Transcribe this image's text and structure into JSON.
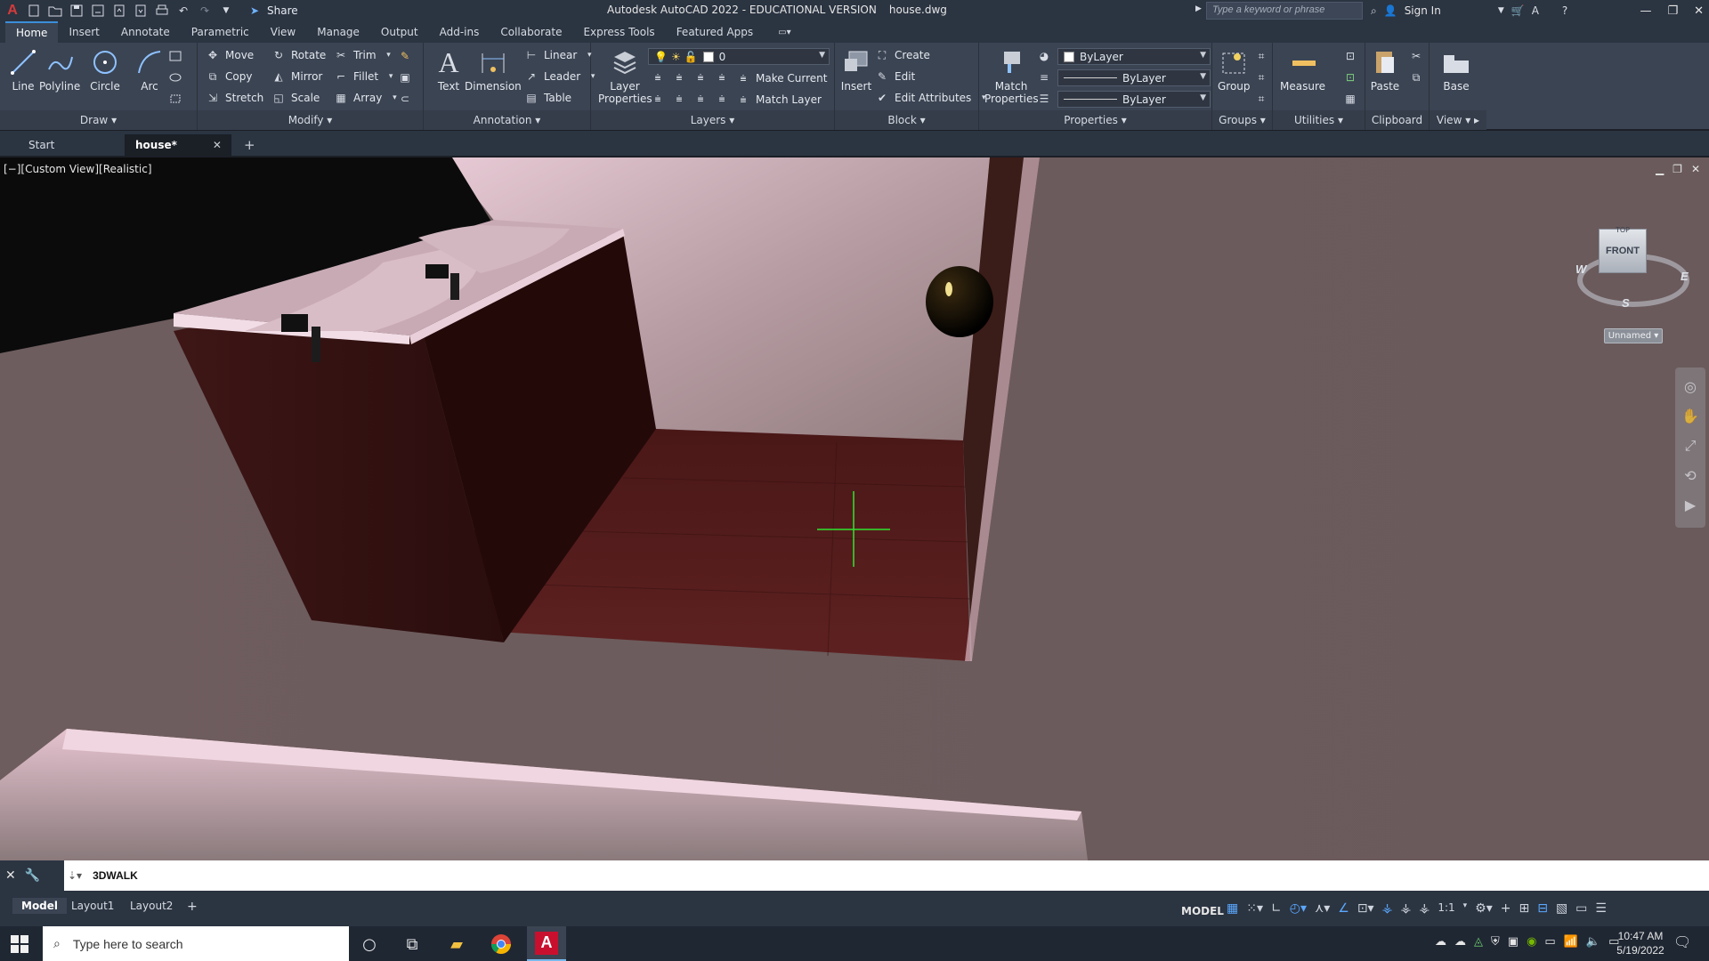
{
  "titlebar": {
    "app_title": "Autodesk AutoCAD 2022 - EDUCATIONAL VERSION",
    "file_name": "house.dwg",
    "share_label": "Share",
    "search_placeholder": "Type a keyword or phrase",
    "sign_in": "Sign In"
  },
  "ribbon_tabs": [
    "Home",
    "Insert",
    "Annotate",
    "Parametric",
    "View",
    "Manage",
    "Output",
    "Add-ins",
    "Collaborate",
    "Express Tools",
    "Featured Apps"
  ],
  "ribbon": {
    "draw": {
      "label": "Draw",
      "line": "Line",
      "polyline": "Polyline",
      "circle": "Circle",
      "arc": "Arc"
    },
    "modify": {
      "label": "Modify",
      "move": "Move",
      "rotate": "Rotate",
      "trim": "Trim",
      "copy": "Copy",
      "mirror": "Mirror",
      "fillet": "Fillet",
      "stretch": "Stretch",
      "scale": "Scale",
      "array": "Array"
    },
    "annotation": {
      "label": "Annotation",
      "text": "Text",
      "dimension": "Dimension",
      "linear": "Linear",
      "leader": "Leader",
      "table": "Table"
    },
    "layers": {
      "label": "Layers",
      "layer_properties": "Layer Properties",
      "current_layer": "0",
      "make_current": "Make Current",
      "match_layer": "Match Layer"
    },
    "block": {
      "label": "Block",
      "insert": "Insert",
      "create": "Create",
      "edit": "Edit",
      "edit_attributes": "Edit Attributes"
    },
    "properties": {
      "label": "Properties",
      "match_properties": "Match Properties",
      "color": "ByLayer",
      "linetype": "ByLayer",
      "lineweight": "ByLayer"
    },
    "groups": {
      "label": "Groups",
      "group": "Group"
    },
    "utilities": {
      "label": "Utilities",
      "measure": "Measure"
    },
    "clipboard": {
      "label": "Clipboard",
      "paste": "Paste"
    },
    "view": {
      "label": "View",
      "base": "Base"
    }
  },
  "doc_tabs": {
    "start": "Start",
    "active": "house*"
  },
  "viewport": {
    "label": "[−][Custom View][Realistic]",
    "viewcube_face": "FRONT",
    "viewcube_top": "TOP",
    "compass_w": "W",
    "compass_e": "E",
    "compass_s": "S",
    "wcs_label": "Unnamed"
  },
  "command": {
    "text": "3DWALK"
  },
  "layout_tabs": {
    "model": "Model",
    "layout1": "Layout1",
    "layout2": "Layout2"
  },
  "status": {
    "model": "MODEL",
    "scale": "1:1"
  },
  "taskbar": {
    "search": "Type here to search",
    "time": "10:47 AM",
    "date": "5/19/2022"
  },
  "colors": {
    "accent": "#3b8fd9",
    "ribbon_bg": "#3b4453",
    "titlebar_bg": "#2b3441",
    "floor": "#5a1f1f",
    "wall": "#6c5b5c"
  }
}
